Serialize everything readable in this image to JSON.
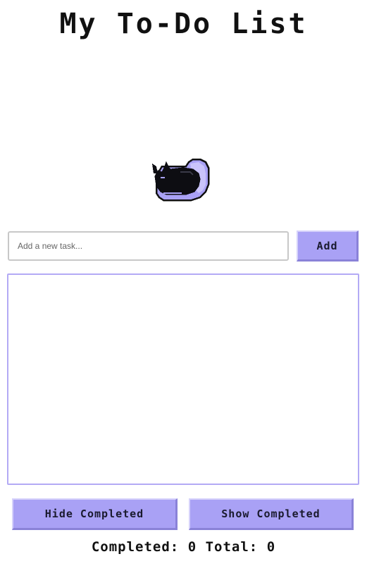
{
  "app": {
    "title": "My To-Do List"
  },
  "mascot": {
    "icon": "sleeping-cat-icon",
    "accent_color": "#a9a1f5"
  },
  "input": {
    "placeholder": "Add a new task...",
    "value": ""
  },
  "buttons": {
    "add_label": "Add",
    "hide_completed_label": "Hide Completed",
    "show_completed_label": "Show Completed"
  },
  "tasks": [],
  "stats": {
    "completed_label": "Completed:",
    "completed_count": "0",
    "total_label": "Total:",
    "total_count": "0"
  },
  "colors": {
    "button_bg": "#a9a1f5",
    "list_border": "#b3aaf5"
  }
}
